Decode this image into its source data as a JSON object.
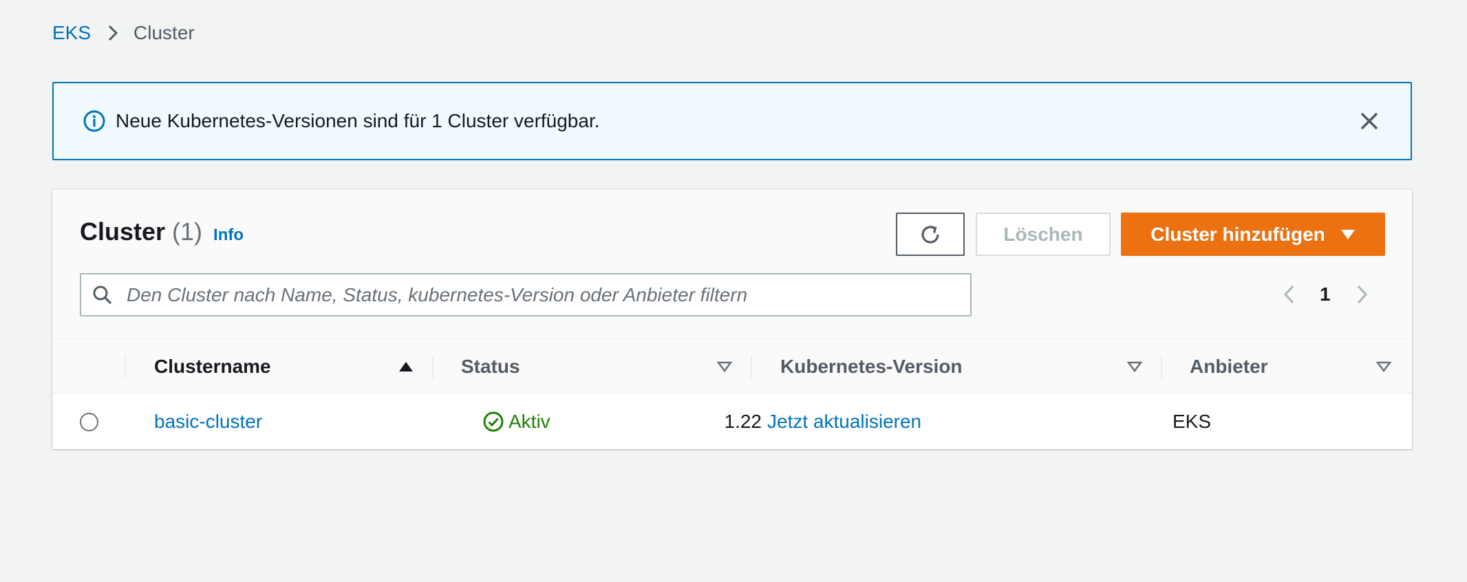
{
  "breadcrumb": {
    "root": "EKS",
    "current": "Cluster"
  },
  "flash": {
    "message": "Neue Kubernetes-Versionen sind für 1 Cluster verfügbar.",
    "icon": "info-icon",
    "close_icon": "close-icon"
  },
  "container": {
    "title": "Cluster",
    "count": "(1)",
    "info_link": "Info",
    "refresh_icon": "refresh-icon",
    "delete_label": "Löschen",
    "add_label": "Cluster hinzufügen"
  },
  "search": {
    "placeholder": "Den Cluster nach Name, Status, kubernetes-Version oder Anbieter filtern",
    "value": ""
  },
  "pagination": {
    "current_page": "1"
  },
  "table": {
    "columns": [
      "Clustername",
      "Status",
      "Kubernetes-Version",
      "Anbieter"
    ],
    "sorted_column": "Clustername",
    "sort_direction": "ascending",
    "rows": [
      {
        "name": "basic-cluster",
        "status": "Aktiv",
        "version": "1.22",
        "version_action": "Jetzt aktualisieren",
        "provider": "EKS"
      }
    ]
  },
  "colors": {
    "link": "#0073bb",
    "primary_button": "#ec7211",
    "success": "#1d8102",
    "info_banner_bg": "#f1faff",
    "info_banner_border": "#0073bb"
  }
}
